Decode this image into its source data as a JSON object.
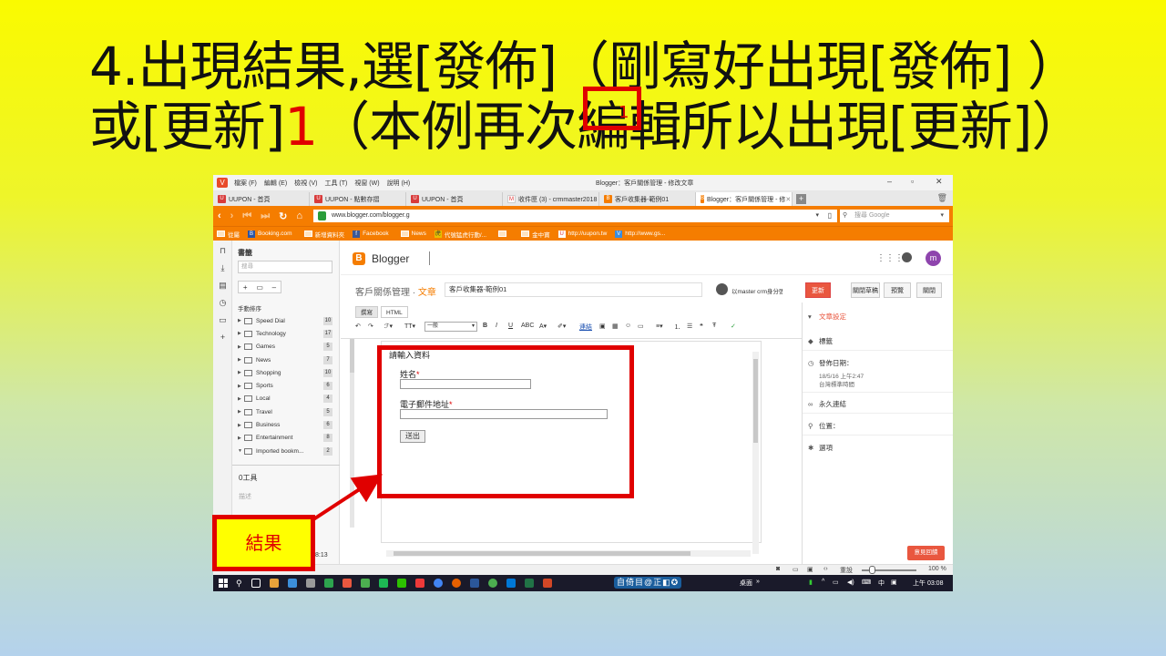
{
  "slide": {
    "title_line1": "4.出現結果,選[發佈]（剛寫好出現[發佈] ）",
    "title_line2a": "或[更新]",
    "title_num": "1",
    "title_line2b": "（本例再次編輯所以出現[更新]）",
    "result_label": "結果",
    "highlight_num": "1"
  },
  "window": {
    "menu": [
      "檔案 (F)",
      "編輯 (E)",
      "檢視 (V)",
      "工具 (T)",
      "視窗 (W)",
      "說明 (H)"
    ],
    "title": "Blogger：客戶關係管理 - 修改文章"
  },
  "tabs": [
    {
      "icon": "U",
      "label": "UUPON - 首頁"
    },
    {
      "icon": "U",
      "label": "UUPON - 點數存摺"
    },
    {
      "icon": "U",
      "label": "UUPON - 首頁"
    },
    {
      "icon": "M",
      "label": "收件匣 (3) - crmmaster2018"
    },
    {
      "icon": "B",
      "label": "客戶收集器-範例01"
    },
    {
      "icon": "B",
      "label": "Blogger：客戶關係管理 - 修"
    }
  ],
  "address": {
    "url": "www.blogger.com/blogger.g",
    "search_placeholder": "搜尋 Google"
  },
  "bookmarks_bar": [
    "從屬",
    "Booking.com",
    "新增資料夾",
    "Facebook",
    "News",
    "代號猛虎行動/...",
    "",
    "金中寶",
    "http://uupon.tw",
    "http://www.gs..."
  ],
  "bookmark_panel": {
    "title": "書籤",
    "search_placeholder": "搜尋",
    "sort_label": "手動排序",
    "items": [
      {
        "name": "Speed Dial",
        "count": "10"
      },
      {
        "name": "Technology",
        "count": "17"
      },
      {
        "name": "Games",
        "count": "5"
      },
      {
        "name": "News",
        "count": "7"
      },
      {
        "name": "Shopping",
        "count": "10"
      },
      {
        "name": "Sports",
        "count": "6"
      },
      {
        "name": "Local",
        "count": "4"
      },
      {
        "name": "Travel",
        "count": "5"
      },
      {
        "name": "Business",
        "count": "6"
      },
      {
        "name": "Entertainment",
        "count": "8"
      },
      {
        "name": "Imported bookm...",
        "count": "2"
      }
    ],
    "detail_title": "0工具",
    "detail_desc": "描述",
    "time_partial": "8:13"
  },
  "blogger": {
    "app_name": "Blogger",
    "avatar_letter": "m",
    "breadcrumb_blog": "客戶關係管理",
    "breadcrumb_sep": " · ",
    "breadcrumb_page": "文章",
    "post_title": "客戶收集器-範例01",
    "author": "以master crm身分張貼",
    "buttons": {
      "update": "更新",
      "close": "關閉草稿",
      "preview": "預覽",
      "close2": "關閉"
    },
    "mode_tabs": {
      "compose": "撰寫",
      "html": "HTML"
    },
    "font_select": "一般"
  },
  "editor": {
    "heading": "請輸入資料",
    "name_label": "姓名",
    "email_label": "電子郵件地址",
    "required_mark": "*",
    "submit_label": "送出"
  },
  "post_settings": {
    "header": "文章設定",
    "labels": "標籤",
    "publish_date": "發佈日期：",
    "date_value": "18/5/16 上午2:47",
    "timezone": "台灣標準時間",
    "permalink": "永久連結",
    "location": "位置：",
    "options": "選項",
    "feedback": "意見回饋"
  },
  "statusbar": {
    "reset": "重設",
    "zoom": "100 %"
  },
  "taskbar": {
    "ime": "自倚目@正◧✪",
    "desktop": "桌面",
    "lang": "中",
    "time": "上午 03:08"
  }
}
